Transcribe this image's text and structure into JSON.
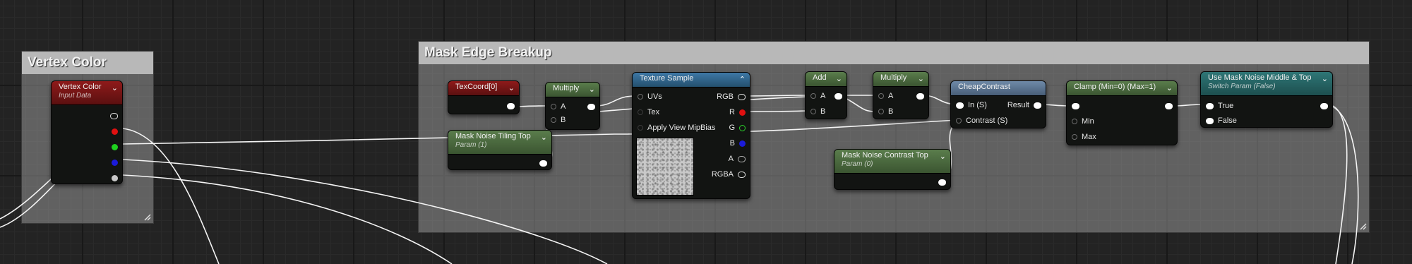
{
  "comments": {
    "vertex_color": "Vertex Color",
    "mask_edge": "Mask Edge Breakup"
  },
  "vertex_color_node": {
    "title": "Vertex Color",
    "subtitle": "Input Data"
  },
  "texcoord": {
    "title": "TexCoord[0]"
  },
  "multiply1": {
    "title": "Multiply",
    "pin_a": "A",
    "pin_b": "B"
  },
  "tiling_param": {
    "title": "Mask Noise Tiling Top",
    "subtitle": "Param (1)"
  },
  "texture_sample": {
    "title": "Texture Sample",
    "inputs": [
      "UVs",
      "Tex",
      "Apply View MipBias"
    ],
    "outputs": [
      "RGB",
      "R",
      "G",
      "B",
      "A",
      "RGBA"
    ]
  },
  "add": {
    "title": "Add",
    "pin_a": "A",
    "pin_b": "B"
  },
  "multiply2": {
    "title": "Multiply",
    "pin_a": "A",
    "pin_b": "B"
  },
  "cheap_contrast": {
    "title": "CheapContrast",
    "in": "In (S)",
    "contrast": "Contrast (S)",
    "result": "Result"
  },
  "contrast_param": {
    "title": "Mask Noise Contrast Top",
    "subtitle": "Param (0)"
  },
  "clamp": {
    "title": "Clamp (Min=0) (Max=1)",
    "min": "Min",
    "max": "Max"
  },
  "switch_param": {
    "title": "Use Mask Noise Middle & Top",
    "subtitle": "Switch Param (False)",
    "true_label": "True",
    "false_label": "False"
  },
  "icons": {
    "collapse": "chevron-down-icon",
    "collapse_up": "chevron-up-icon",
    "resize": "resize-grip-icon"
  }
}
